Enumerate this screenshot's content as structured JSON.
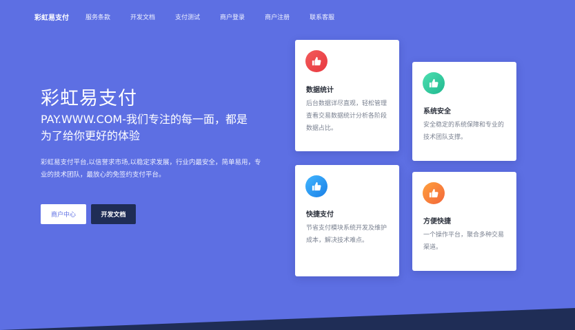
{
  "nav": {
    "brand": "彩虹易支付",
    "links": [
      "服务条款",
      "开发文档",
      "支付测试",
      "商户登录",
      "商户注册",
      "联系客服"
    ]
  },
  "hero": {
    "title": "彩虹易支付",
    "subtitle": "PAY.WWW.COM-我们专注的每一面，都是为了给你更好的体验",
    "description": "彩虹易支付平台,以信誉求市场,以稳定求发展，行业内最安全，简单易用，专业的技术团队，最放心的免签约支付平台。",
    "buttons": {
      "merchant": "商户中心",
      "docs": "开发文档"
    }
  },
  "cards": [
    {
      "title": "数据统计",
      "text": "后台数据详尽直观，轻松管理查看交易数据统计分析各阶段数据占比。",
      "icon": "thumbs-up-icon",
      "gradient": [
        "#f25b5b",
        "#e8383f"
      ]
    },
    {
      "title": "系统安全",
      "text": "安全稳定的系统保障和专业的技术团队支撑。",
      "icon": "thumbs-up-icon",
      "gradient": [
        "#4ddfb0",
        "#20b88f"
      ]
    },
    {
      "title": "快捷支付",
      "text": "节省支付模块系统开发及维护成本，解决技术难点。",
      "icon": "thumbs-up-icon",
      "gradient": [
        "#42b6ff",
        "#1a7fe6"
      ]
    },
    {
      "title": "方便快捷",
      "text": "一个操作平台，聚合多种交易渠道。",
      "icon": "thumbs-up-icon",
      "gradient": [
        "#ffa03d",
        "#f2663a"
      ]
    }
  ],
  "colors": {
    "background": "#5d6fe3",
    "dark_band": "#1f2d56"
  }
}
